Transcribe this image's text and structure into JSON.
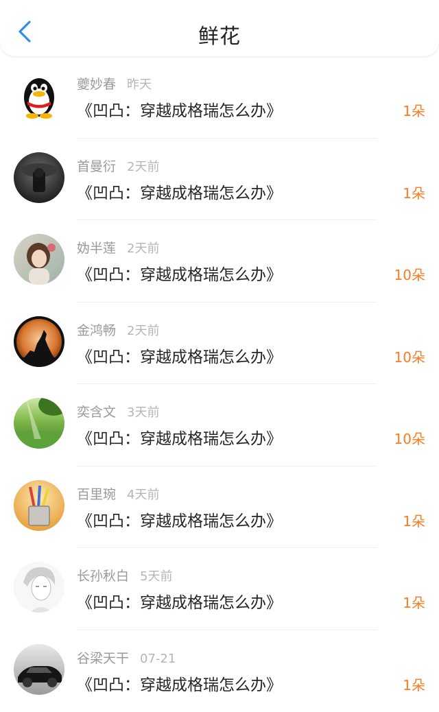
{
  "header": {
    "title": "鲜花",
    "back_icon": "chevron-left-icon",
    "accent_color": "#2e8fea"
  },
  "count_color": "#ff7a1f",
  "rows": [
    {
      "name": "夔妙春",
      "time": "昨天",
      "book": "《凹凸：穿越成格瑞怎么办》",
      "count": "1朵",
      "avatar": "qq-penguin-avatar"
    },
    {
      "name": "首曼衍",
      "time": "2天前",
      "book": "《凹凸：穿越成格瑞怎么办》",
      "count": "1朵",
      "avatar": "dark-figure-avatar"
    },
    {
      "name": "妫半莲",
      "time": "2天前",
      "book": "《凹凸：穿越成格瑞怎么办》",
      "count": "10朵",
      "avatar": "girl-photo-avatar"
    },
    {
      "name": "金鸿畅",
      "time": "2天前",
      "book": "《凹凸：穿越成格瑞怎么办》",
      "count": "10朵",
      "avatar": "howling-wolf-avatar"
    },
    {
      "name": "奕含文",
      "time": "3天前",
      "book": "《凹凸：穿越成格瑞怎么办》",
      "count": "10朵",
      "avatar": "green-forest-avatar"
    },
    {
      "name": "百里琬",
      "time": "4天前",
      "book": "《凹凸：穿越成格瑞怎么办》",
      "count": "1朵",
      "avatar": "pencil-cup-avatar"
    },
    {
      "name": "长孙秋白",
      "time": "5天前",
      "book": "《凹凸：穿越成格瑞怎么办》",
      "count": "1朵",
      "avatar": "sketch-boy-avatar"
    },
    {
      "name": "谷梁天干",
      "time": "07-21",
      "book": "《凹凸：穿越成格瑞怎么办》",
      "count": "1朵",
      "avatar": "black-car-avatar"
    }
  ]
}
